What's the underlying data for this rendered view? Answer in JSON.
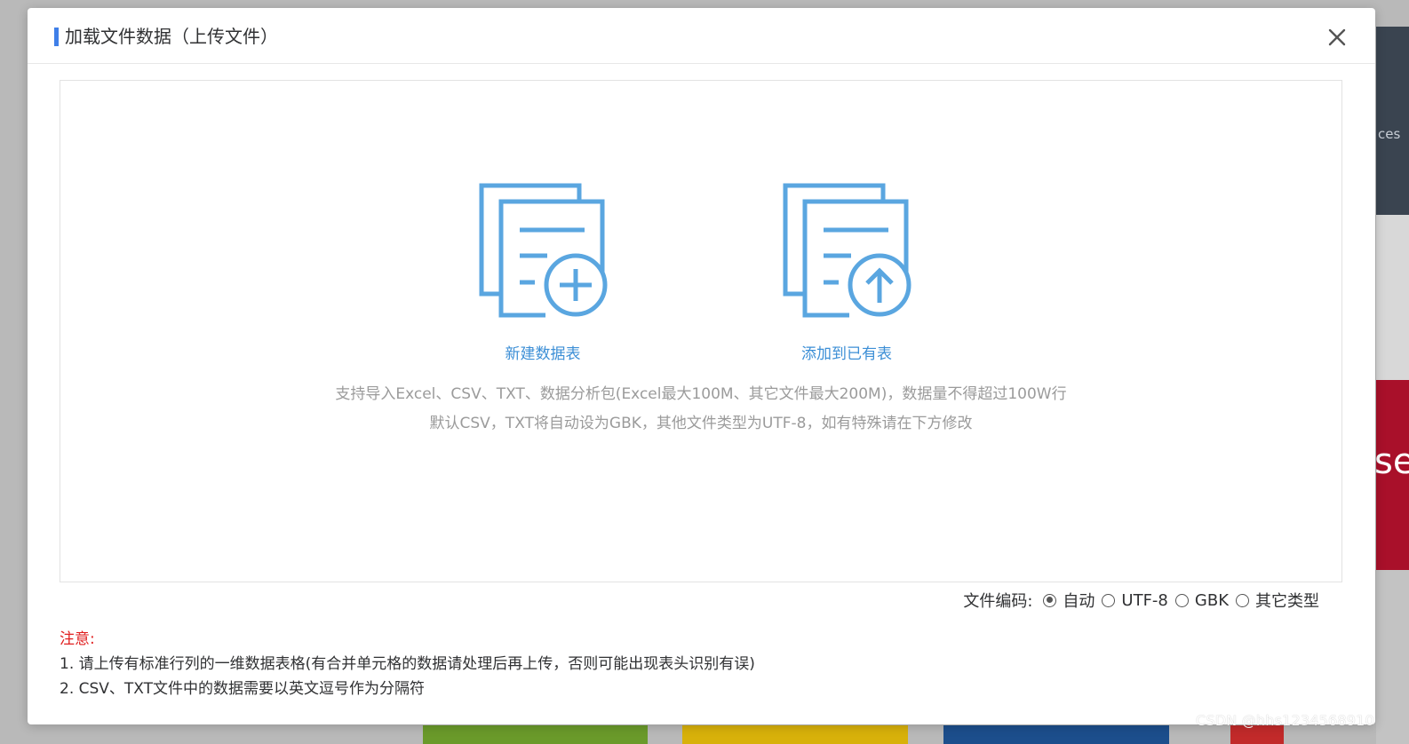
{
  "background": {
    "right_text_1": "ces",
    "right_text_2": "se",
    "watermark": "CSDN @hhs1234568910"
  },
  "modal": {
    "title": "加载文件数据（上传文件）",
    "close_icon": "close-icon",
    "accent_color": "#3f7fe8",
    "options": {
      "new_table": {
        "label": "新建数据表",
        "icon": "document-add-icon"
      },
      "append_table": {
        "label": "添加到已有表",
        "icon": "document-upload-icon"
      }
    },
    "hints": {
      "line1": "支持导入Excel、CSV、TXT、数据分析包(Excel最大100M、其它文件最大200M)，数据量不得超过100W行",
      "line2": "默认CSV，TXT将自动设为GBK，其他文件类型为UTF-8，如有特殊请在下方修改"
    },
    "encoding": {
      "label": "文件编码:",
      "options": [
        "自动",
        "UTF-8",
        "GBK",
        "其它类型"
      ],
      "selected": "自动"
    },
    "notes": {
      "title": "注意:",
      "line1": "1. 请上传有标准行列的一维数据表格(有合并单元格的数据请处理后再上传，否则可能出现表头识别有误)",
      "line2": "2. CSV、TXT文件中的数据需要以英文逗号作为分隔符"
    }
  }
}
